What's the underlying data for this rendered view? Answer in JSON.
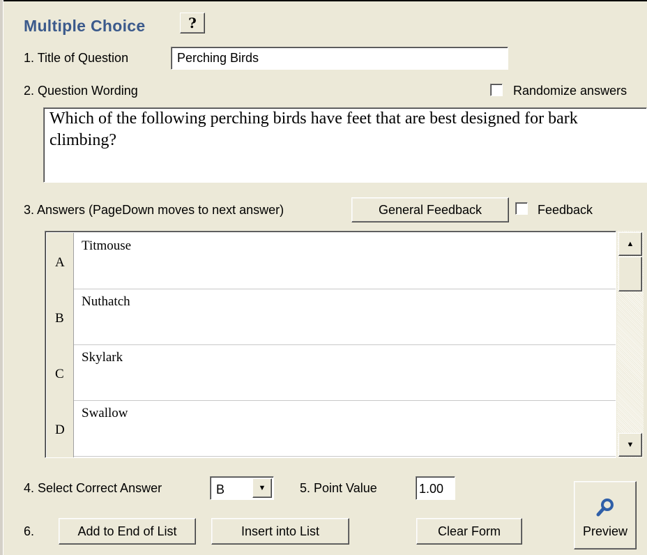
{
  "header": {
    "title": "Multiple Choice",
    "help_label": "?"
  },
  "q1": {
    "label": "1.  Title of Question",
    "value": "Perching Birds"
  },
  "q2": {
    "label": "2.  Question Wording",
    "randomize_label": "Randomize answers",
    "randomize_checked": false,
    "wording": "Which of the following perching birds have feet that are best designed for bark climbing?"
  },
  "q3": {
    "label": "3.  Answers  (PageDown moves to next answer)",
    "general_feedback_label": "General Feedback",
    "feedback_label": "Feedback",
    "feedback_checked": false,
    "answers": [
      {
        "letter": "A",
        "text": "Titmouse"
      },
      {
        "letter": "B",
        "text": "Nuthatch"
      },
      {
        "letter": "C",
        "text": "Skylark"
      },
      {
        "letter": "D",
        "text": "Swallow"
      }
    ]
  },
  "q4": {
    "label": "4.  Select Correct Answer",
    "selected": "B"
  },
  "q5": {
    "label": "5.  Point Value",
    "value": "1.00"
  },
  "q6": {
    "label": "6.",
    "add_label": "Add to End of List",
    "insert_label": "Insert into List",
    "clear_label": "Clear Form",
    "preview_label": "Preview"
  },
  "icons": {
    "help": "question-mark-icon",
    "preview": "magnifier-icon",
    "scroll_up": "arrow-up-icon",
    "scroll_down": "arrow-down-icon",
    "dropdown": "chevron-down-icon"
  },
  "colors": {
    "title": "#3b5a8c",
    "face": "#ece9d8",
    "preview_icon": "#2f5fa8"
  }
}
